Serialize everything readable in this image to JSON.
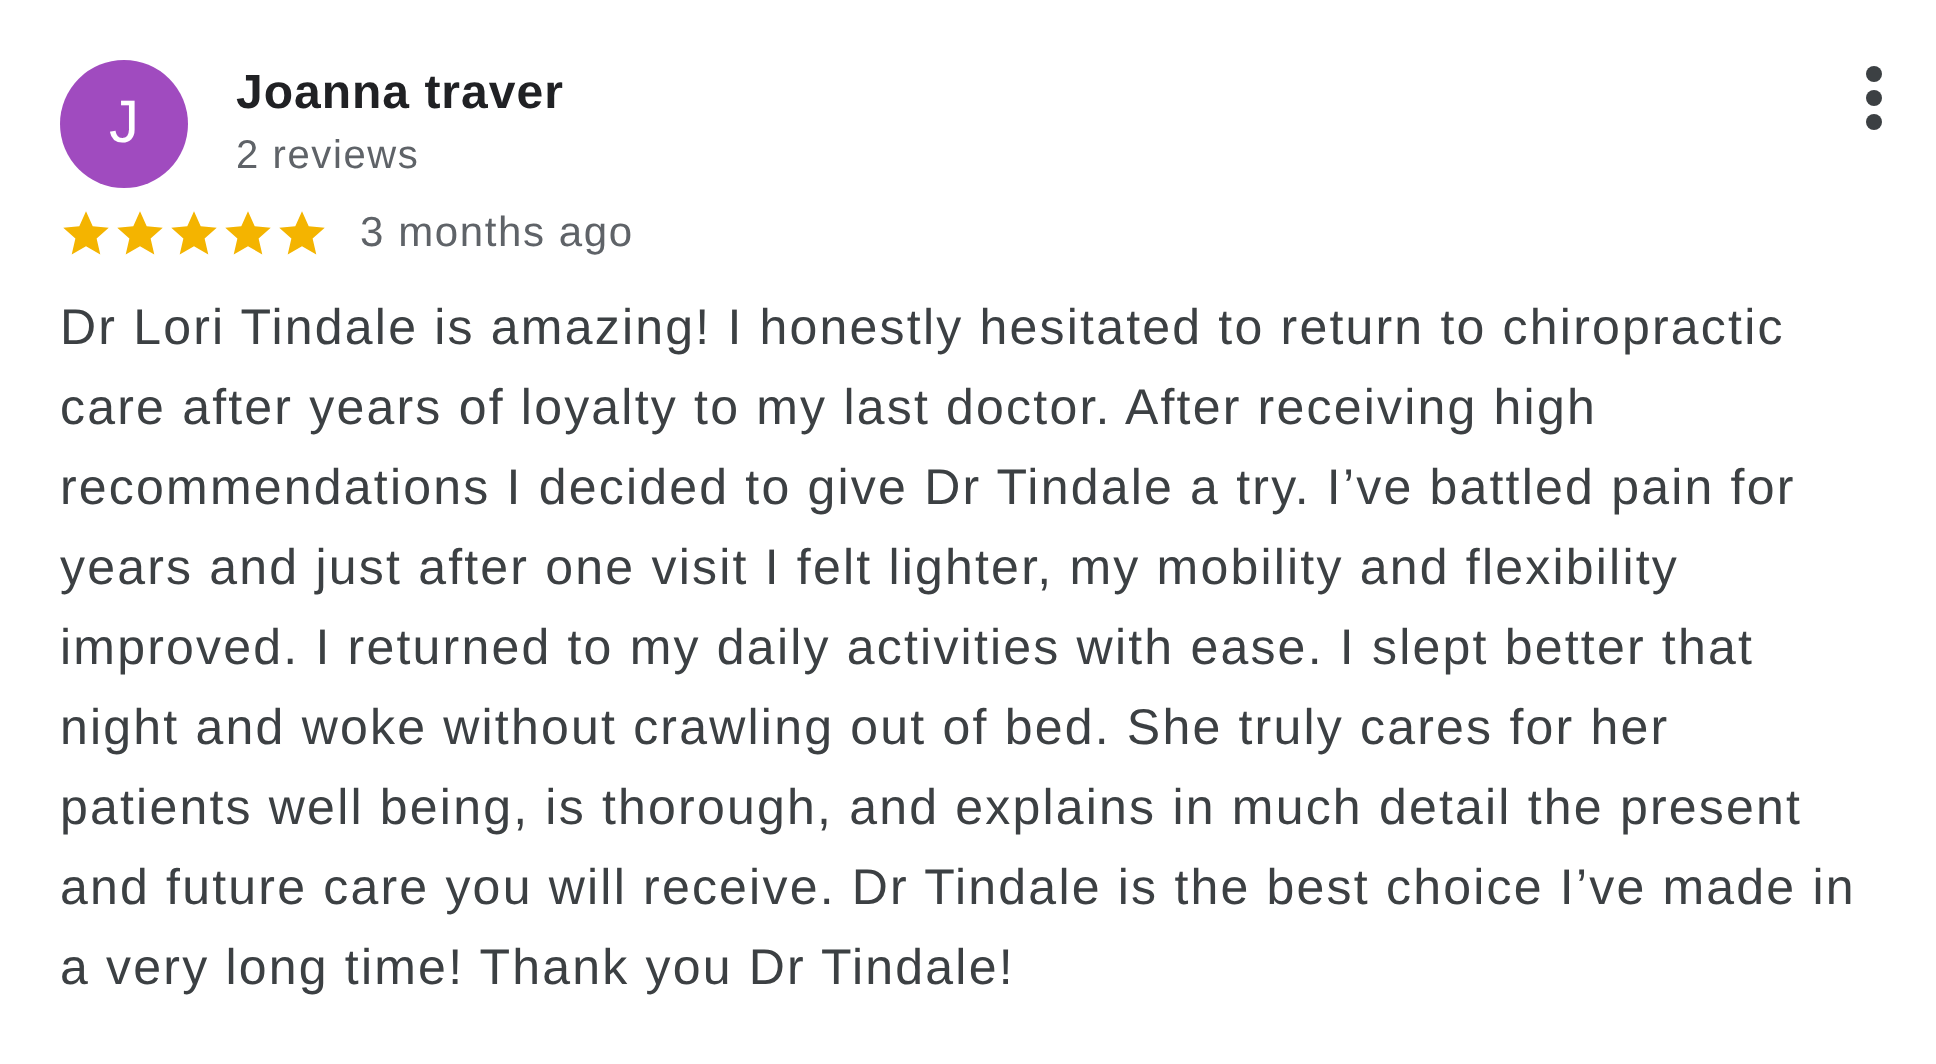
{
  "review": {
    "avatar": {
      "letter": "J",
      "color": "#a04bbf"
    },
    "author": "Joanna traver",
    "review_count": "2 reviews",
    "stars": 5,
    "time": "3 months ago",
    "text": "Dr Lori Tindale is amazing! I honestly hesitated to return to chiropractic care after years of loyalty to my last doctor. After receiving high recommendations I decided to give Dr Tindale a try. I’ve battled pain for years and just after one visit I felt lighter, my mobility and flexibility improved. I returned to my daily activities with ease. I slept better that night and woke without crawling out of bed. She truly cares for her patients well being, is thorough, and explains in much detail the present and future care you will receive. Dr Tindale is the best choice I’ve made in a very long time! Thank you Dr Tindale!"
  }
}
